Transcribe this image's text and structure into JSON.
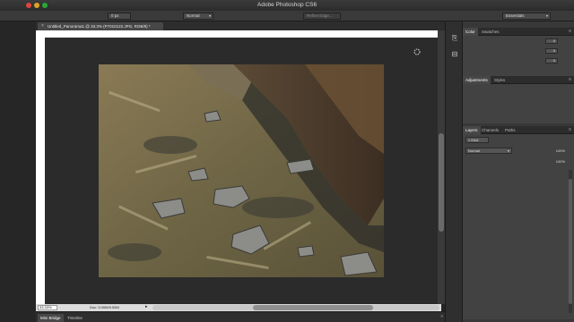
{
  "window": {
    "app_title": "Adobe Photoshop CS6"
  },
  "options_bar": {
    "feather_value": "0 px",
    "style_value": "Normal",
    "refine_edge_label": "Refine Edge...",
    "workspace_value": "Essentials"
  },
  "document": {
    "tab_label": "Untitled_Panorama1 @ 33.3% (P7010122.JPG, RGB/8) *",
    "tab_close": "×"
  },
  "status_bar": {
    "zoom": "33.33%",
    "doc_size": "Doc: 9.00M/9.00M"
  },
  "bottom_tabs": [
    "Mini Bridge",
    "Timeline"
  ],
  "panels": {
    "color": {
      "tabs": [
        "Color",
        "Swatches"
      ],
      "values": [
        "0",
        "0",
        "0"
      ]
    },
    "adjustments": {
      "tabs": [
        "Adjustments",
        "Styles"
      ]
    },
    "layers": {
      "tabs": [
        "Layers",
        "Channels",
        "Paths"
      ],
      "kind_filter": "Kind",
      "blend_mode": "Normal",
      "opacity": "100%",
      "fill": "100%"
    }
  },
  "colors": {
    "accent_close": "#e0443e",
    "accent_min": "#dea123",
    "accent_max": "#27aa35"
  }
}
